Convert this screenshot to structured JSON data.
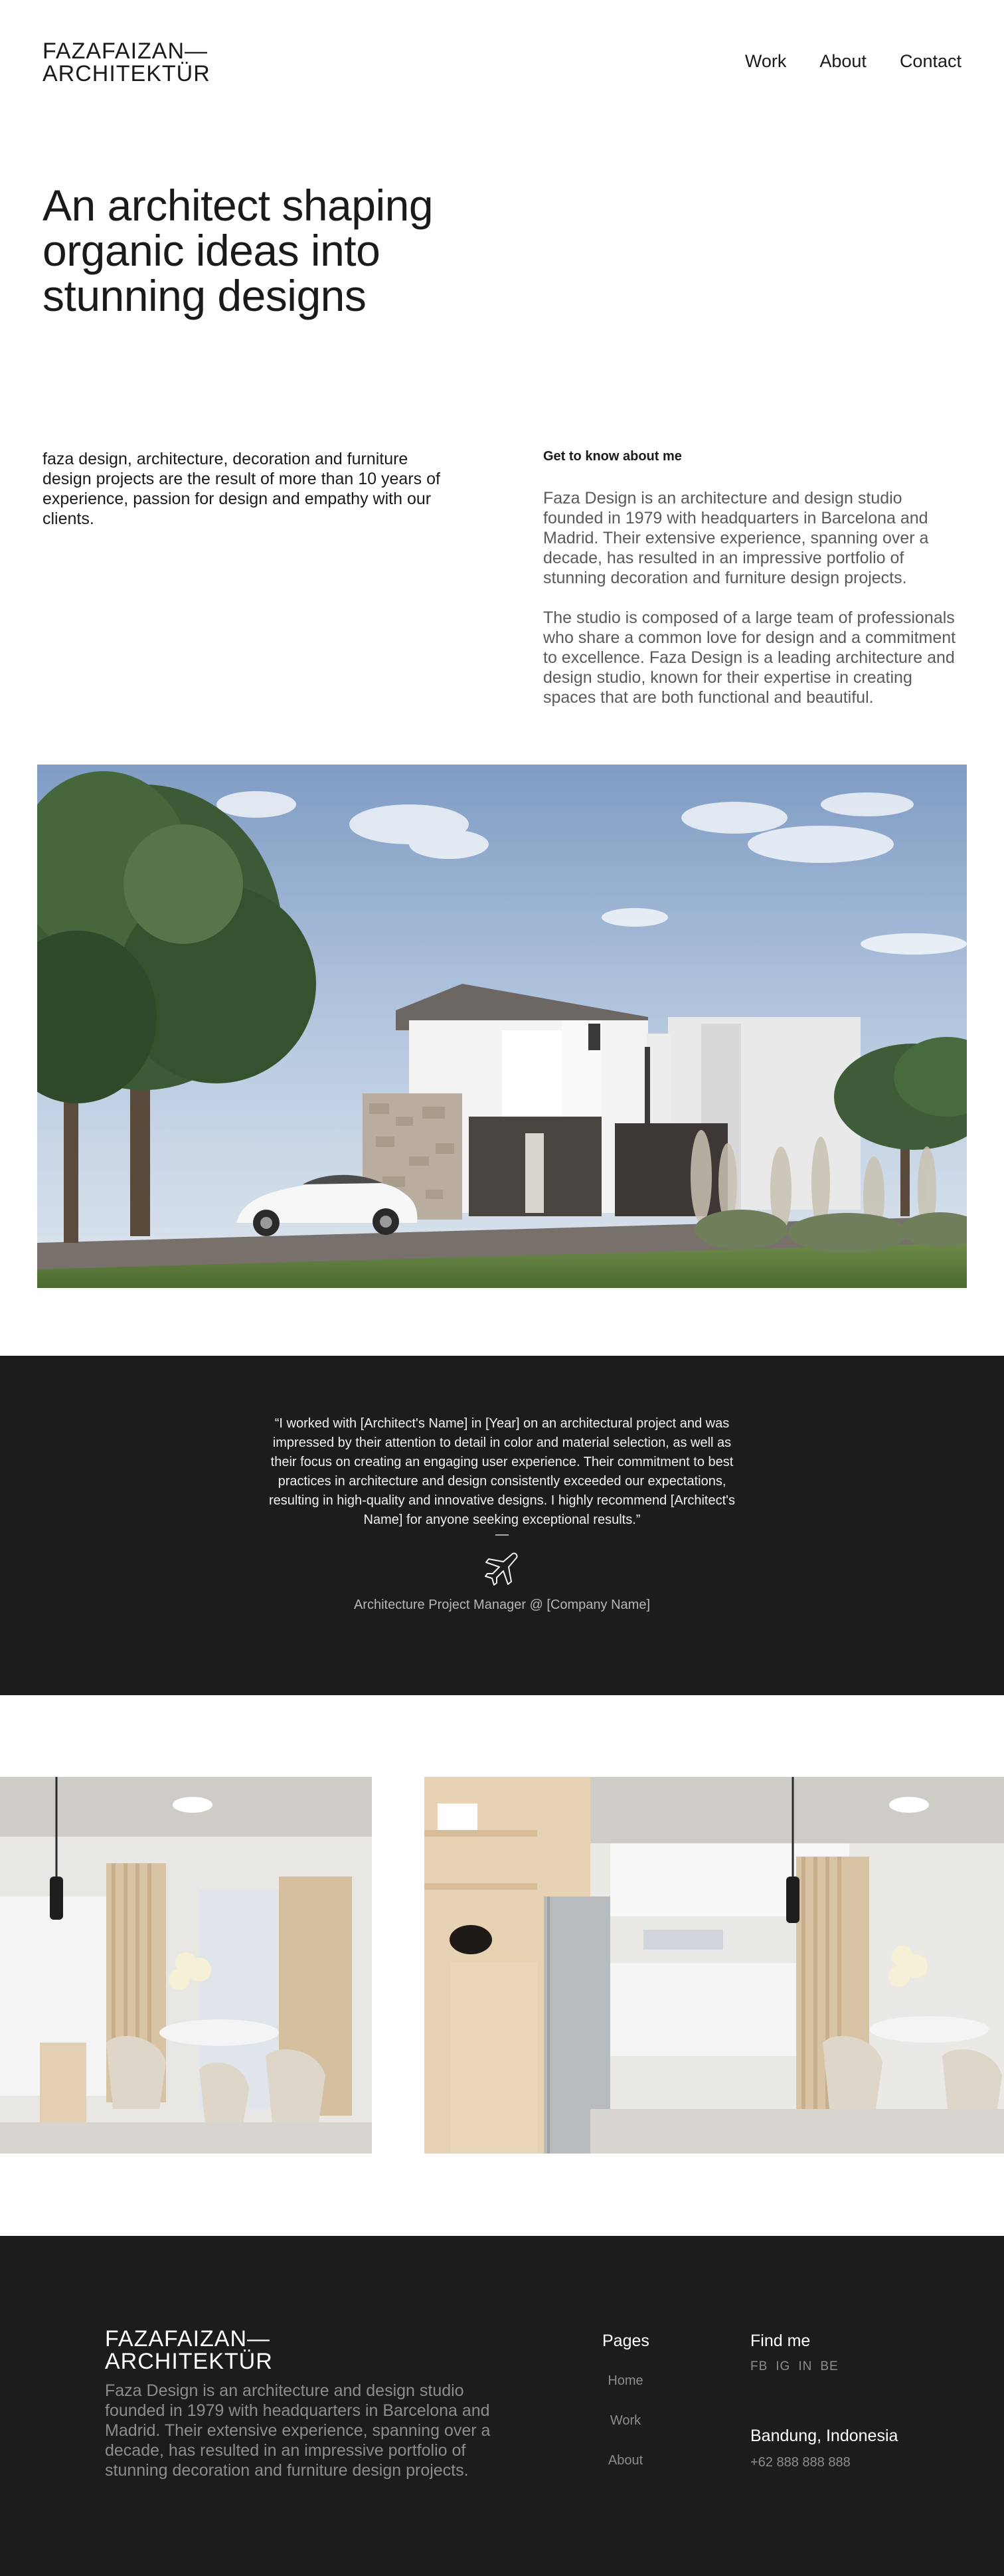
{
  "header": {
    "logo_line1": "FAZAFAIZAN—",
    "logo_line2": "ARCHITEKTÜR",
    "nav": [
      {
        "label": "Work"
      },
      {
        "label": "About"
      },
      {
        "label": "Contact"
      }
    ]
  },
  "hero": {
    "title": "An architect shaping organic ideas into stunning designs"
  },
  "intro": {
    "left_text": "faza design, architecture, decoration and furniture design projects are the result of more than 10 years of experience, passion for design and empathy with our clients.",
    "heading": "Get to know about me",
    "paragraphs": [
      "Faza Design is an architecture and design studio founded in 1979 with headquarters in Barcelona and Madrid. Their extensive experience, spanning over a decade, has resulted in an impressive portfolio of stunning decoration and furniture design projects.",
      "The studio is composed of a large team of professionals who share a common love for design and a commitment to excellence. Faza Design is a leading architecture and design studio, known for their expertise in creating spaces that are both functional and beautiful."
    ]
  },
  "testimonial": {
    "quote": "“I worked with [Architect's Name] in [Year] on an architectural project and was impressed by their attention to detail in color and material selection, as well as their focus on creating an engaging user experience. Their commitment to best practices in architecture and design consistently exceeded our expectations, resulting in high-quality and innovative designs. I highly recommend [Architect's Name] for anyone seeking exceptional results.”",
    "dash": "—",
    "icon": "airplane-icon",
    "role": "Architecture Project Manager @ [Company Name]"
  },
  "footer": {
    "logo_line1": "FAZAFAIZAN—",
    "logo_line2": "ARCHITEKTÜR",
    "description": "Faza Design is an architecture and design studio founded in 1979 with headquarters in Barcelona and Madrid. Their extensive experience, spanning over a decade, has resulted in an impressive portfolio of stunning decoration and furniture design projects.",
    "pages_title": "Pages",
    "pages": [
      {
        "label": "Home"
      },
      {
        "label": "Work"
      },
      {
        "label": "About"
      }
    ],
    "find_title": "Find me",
    "social": [
      {
        "label": "FB"
      },
      {
        "label": "IG"
      },
      {
        "label": "IN"
      },
      {
        "label": "BE"
      }
    ],
    "city": "Bandung, Indonesia",
    "phone": "+62 888 888 888"
  },
  "colors": {
    "text": "#1a1a1a",
    "muted": "#5a5a5a",
    "dark_bg": "#1c1c1c",
    "footer_muted": "#8d8d8d"
  }
}
